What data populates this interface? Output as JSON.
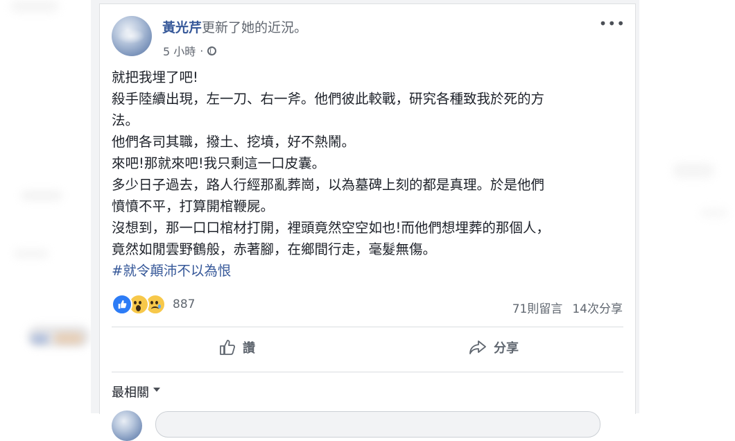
{
  "post": {
    "author": "黃光芹",
    "action_text": "更新了她的近況。",
    "time": "5 小時",
    "more_label": "•••",
    "lines": [
      "就把我埋了吧!",
      "殺手陸續出現，左一刀、右一斧。他們彼此較戰，研究各種致我於死的方",
      "法。",
      "他們各司其職，撥土、挖墳，好不熱鬧。",
      "來吧!那就來吧!我只剩這一口皮囊。",
      "多少日子過去，路人行經那亂葬崗，以為墓碑上刻的都是真理。於是他們",
      "憤憤不平，打算開棺鞭屍。",
      "沒想到，那一口口棺材打開，裡頭竟然空空如也!而他們想埋葬的那個人，",
      "竟然如閒雲野鶴般，赤著腳，在鄉間行走，毫髮無傷。"
    ],
    "hashtag": "#就令顛沛不以為恨",
    "reaction_count": "887",
    "comments": "71則留言",
    "shares": "14次分享",
    "like_label": "讚",
    "share_label": "分享",
    "sort_label": "最相關"
  },
  "colors": {
    "link": "#365899",
    "text": "#1d2129",
    "muted": "#606770"
  }
}
